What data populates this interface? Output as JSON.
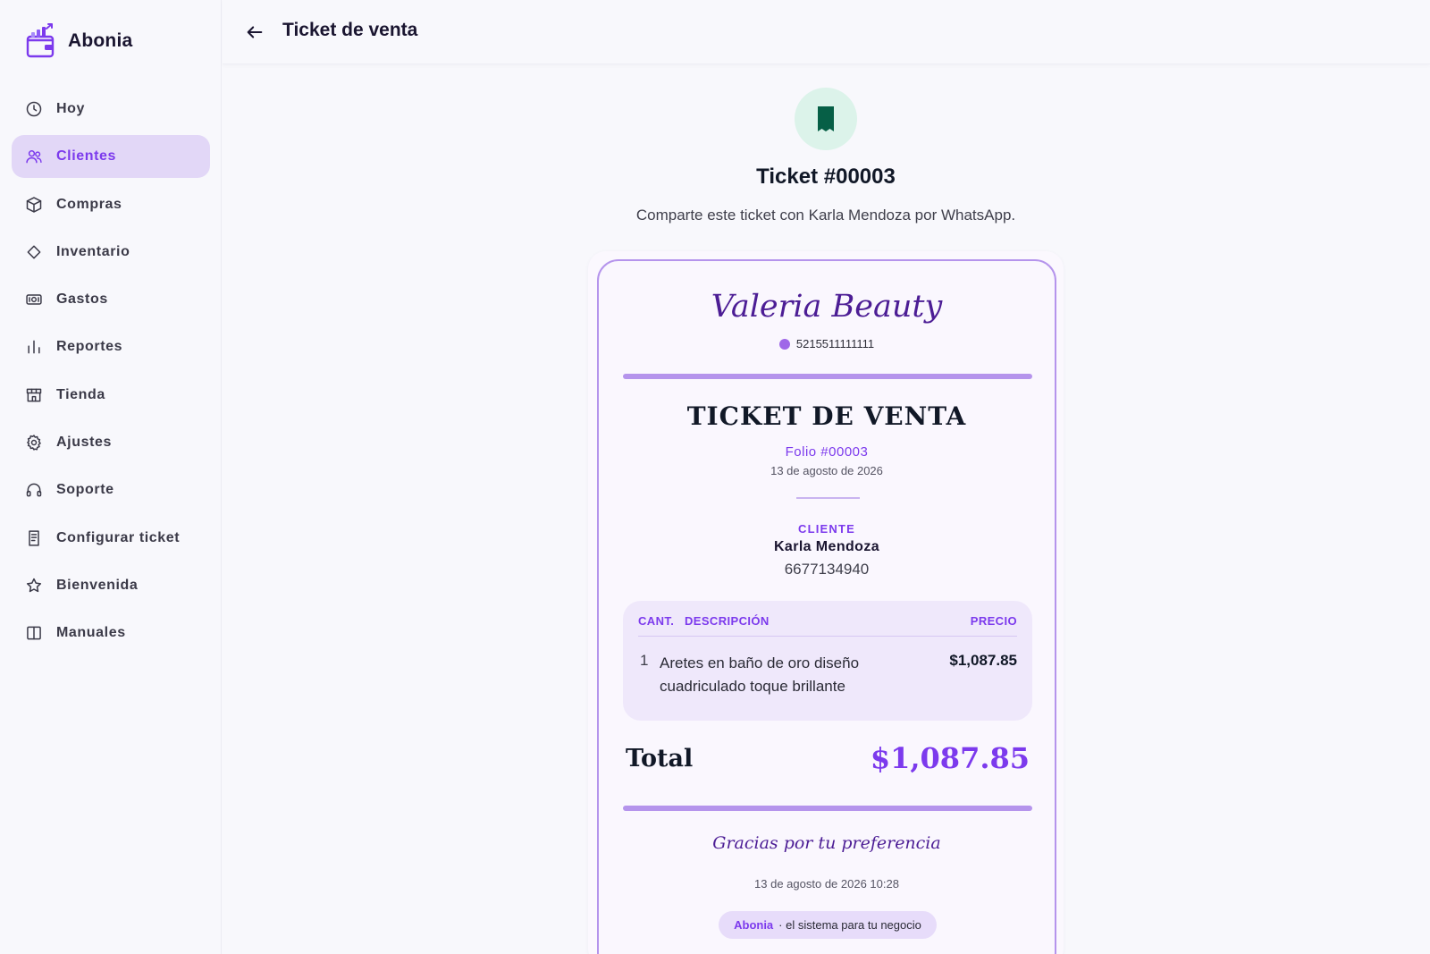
{
  "app": {
    "name": "Abonia"
  },
  "sidebar": {
    "items": [
      {
        "label": "Hoy",
        "icon": "clock-icon",
        "active": false
      },
      {
        "label": "Clientes",
        "icon": "users-icon",
        "active": true
      },
      {
        "label": "Compras",
        "icon": "box-icon",
        "active": false
      },
      {
        "label": "Inventario",
        "icon": "diamond-icon",
        "active": false
      },
      {
        "label": "Gastos",
        "icon": "banknote-icon",
        "active": false
      },
      {
        "label": "Reportes",
        "icon": "bar-chart-icon",
        "active": false
      },
      {
        "label": "Tienda",
        "icon": "store-icon",
        "active": false
      },
      {
        "label": "Ajustes",
        "icon": "gear-icon",
        "active": false
      },
      {
        "label": "Soporte",
        "icon": "headphones-icon",
        "active": false
      },
      {
        "label": "Configurar ticket",
        "icon": "receipt-icon",
        "active": false
      },
      {
        "label": "Bienvenida",
        "icon": "star-icon",
        "active": false
      },
      {
        "label": "Manuales",
        "icon": "book-icon",
        "active": false
      }
    ]
  },
  "header": {
    "title": "Ticket de venta"
  },
  "main": {
    "heading": "Ticket #00003",
    "subtitle": "Comparte este ticket con Karla Mendoza por WhatsApp."
  },
  "ticket": {
    "store_name": "Valeria Beauty",
    "store_phone": "5215511111111",
    "title": "TICKET DE VENTA",
    "folio": "Folio #00003",
    "date": "13 de agosto de 2026",
    "client_label": "CLIENTE",
    "client_name": "Karla Mendoza",
    "client_phone": "6677134940",
    "columns": {
      "qty": "CANT.",
      "desc": "DESCRIPCIÓN",
      "price": "PRECIO"
    },
    "items": [
      {
        "qty": "1",
        "description": "Aretes en baño de oro diseño cuadriculado toque brillante",
        "price": "$1,087.85"
      }
    ],
    "total_label": "Total",
    "total_value": "$1,087.85",
    "thanks": "Gracias por tu preferencia",
    "timestamp": "13 de agosto de 2026 10:28",
    "powered_brand": "Abonia",
    "powered_text": "· el sistema para tu negocio"
  },
  "colors": {
    "accent": "#7c3aed",
    "accent_soft": "#e2d7f7",
    "ticket_border": "#b594ec",
    "store_name": "#4c1d95",
    "badge_bg": "#dcf3ea",
    "badge_icon": "#065f46"
  }
}
